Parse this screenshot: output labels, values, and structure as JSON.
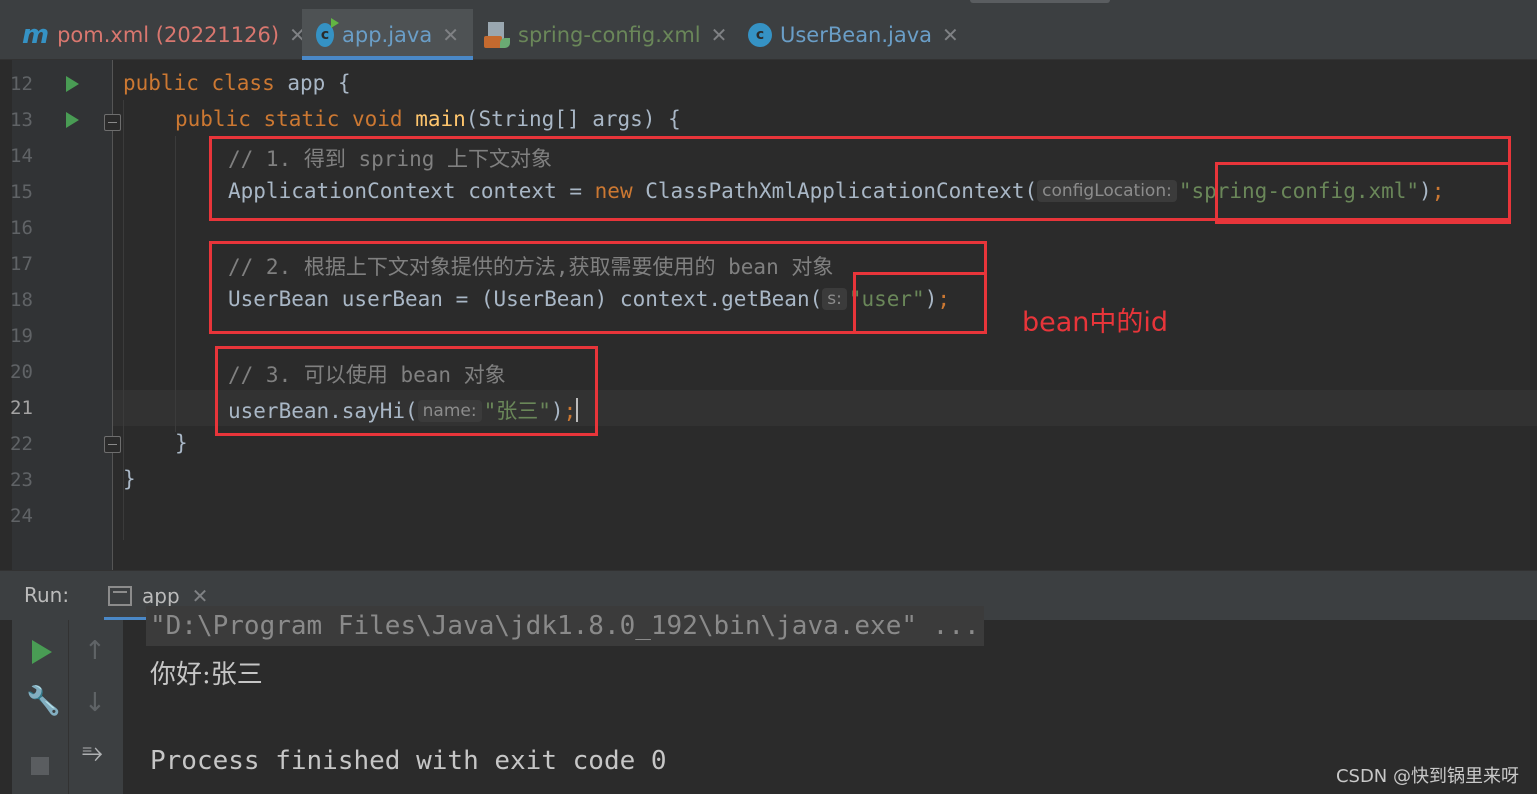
{
  "tabs": [
    {
      "label": "pom.xml (20221126)",
      "icon": "maven-m-icon",
      "color": "#d9776f"
    },
    {
      "label": "app.java",
      "icon": "java-class-run-icon",
      "color": "#6a9ec7",
      "active": true
    },
    {
      "label": "spring-config.xml",
      "icon": "xml-spring-icon",
      "color": "#6a8759"
    },
    {
      "label": "UserBean.java",
      "icon": "java-class-icon",
      "color": "#6a9ec7"
    }
  ],
  "tab_close_glyph": "✕",
  "line_numbers": [
    "12",
    "13",
    "14",
    "15",
    "16",
    "17",
    "18",
    "19",
    "20",
    "21",
    "22",
    "23",
    "24"
  ],
  "code": {
    "l12_kw": "public class ",
    "l12_rest": "app {",
    "l13_kw1": "public static void ",
    "l13_fn": "main",
    "l13_rest": "(String[] args) {",
    "l14": "// 1. 得到 spring 上下文对象",
    "l15_a": "ApplicationContext context = ",
    "l15_kw": "new ",
    "l15_b": "ClassPathXmlApplicationContext(",
    "l15_hint": "configLocation:",
    "l15_str": "\"spring-config.xml\"",
    "l15_end": ")",
    "l15_semi": ";",
    "l17": "// 2. 根据上下文对象提供的方法,获取需要使用的 bean 对象",
    "l18_a": "UserBean userBean = (UserBean) context.getBean(",
    "l18_hint": "s:",
    "l18_str": "\"user\"",
    "l18_end": ")",
    "l18_semi": ";",
    "l20": "// 3. 可以使用 bean 对象",
    "l21_a": "userBean.sayHi(",
    "l21_hint": "name:",
    "l21_str": "\"张三\"",
    "l21_end": ")",
    "l21_semi": ";",
    "l22": "}",
    "l23": "}"
  },
  "annotation": "bean中的id",
  "run_panel": {
    "label": "Run:",
    "tab_label": "app",
    "command": "\"D:\\Program Files\\Java\\jdk1.8.0_192\\bin\\java.exe\" ...",
    "output": "你好:张三",
    "exit": "Process finished with exit code 0"
  },
  "toolbar_icons": [
    "run-icon",
    "wrench-icon",
    "stop-icon",
    "up-arrow-icon",
    "down-arrow-icon",
    "soft-wrap-icon"
  ],
  "watermark": "CSDN @快到锅里来呀",
  "colors": {
    "keyword": "#cc7832",
    "string": "#6a8759",
    "comment": "#808080",
    "function": "#ffc66d",
    "highlight": "#e8353a",
    "accent": "#4a88c7"
  }
}
